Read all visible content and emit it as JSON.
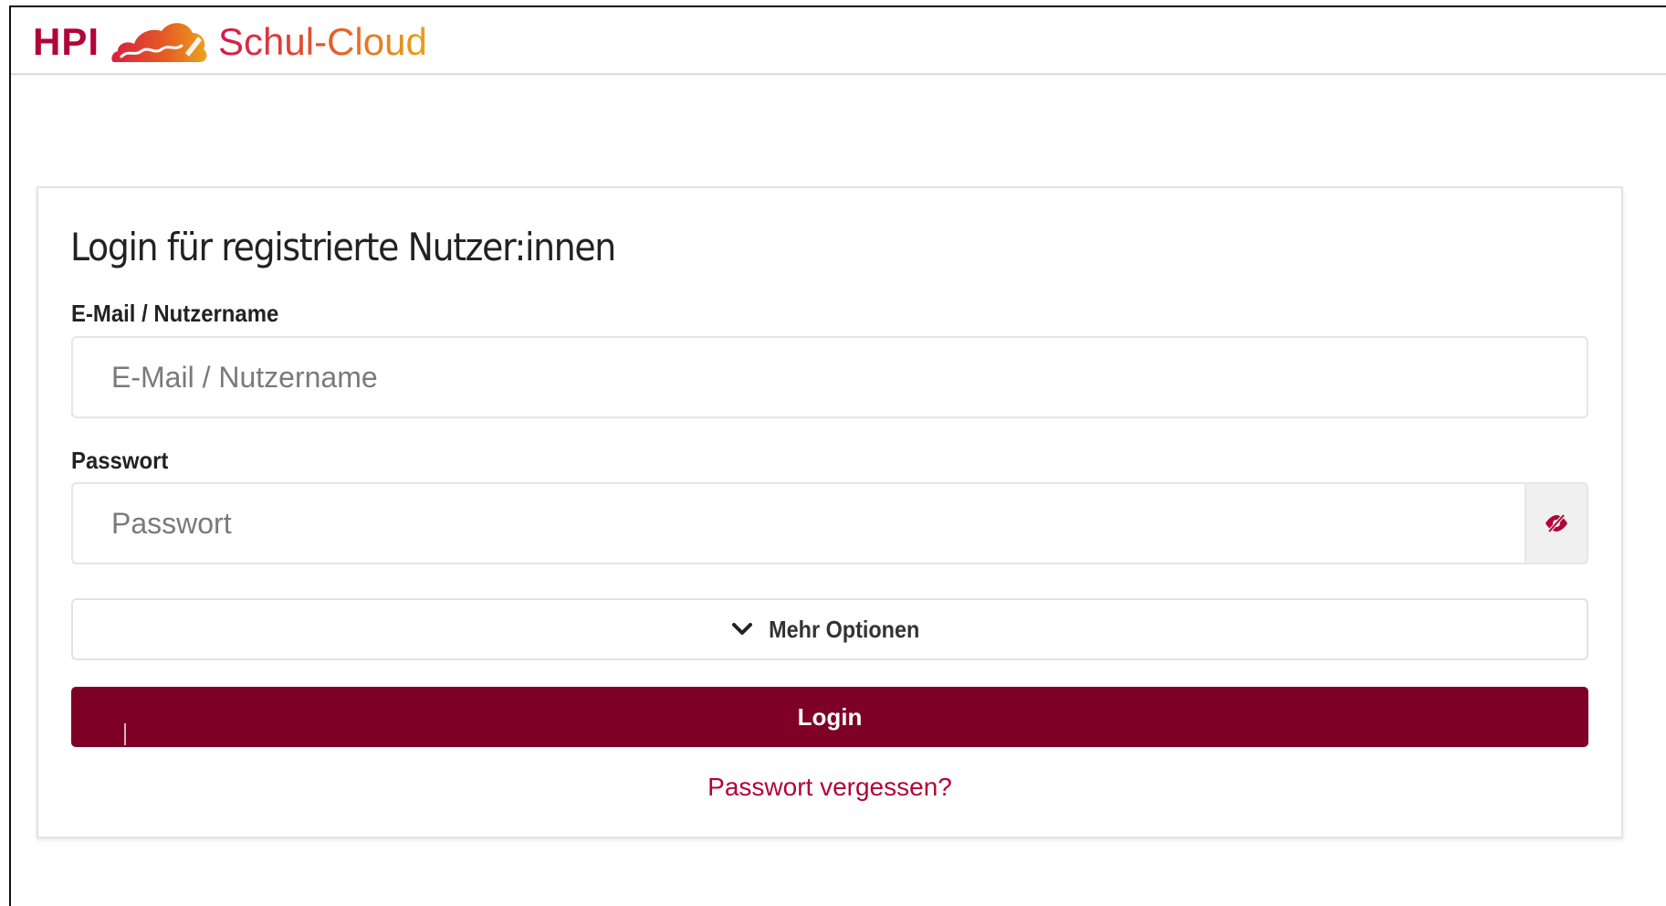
{
  "header": {
    "logo_hpi": "HPI",
    "logo_name": "Schul-Cloud",
    "logo_icon": "cloud-logo-icon"
  },
  "login": {
    "title": "Login für registrierte Nutzer:innen",
    "email_label": "E-Mail / Nutzername",
    "email_placeholder": "E-Mail / Nutzername",
    "email_value": "",
    "password_label": "Passwort",
    "password_placeholder": "Passwort",
    "password_value": "",
    "toggle_visibility_icon": "eye-slash-icon",
    "more_options_icon": "chevron-down-icon",
    "more_options_label": "Mehr Optionen",
    "login_button_label": "Login",
    "forgot_password_label": "Passwort vergessen?"
  },
  "colors": {
    "brand_primary": "#7e0027",
    "brand_accent": "#b10438",
    "logo_gradient_start": "#d21b4d",
    "logo_gradient_end": "#e8a21a",
    "input_border": "#e6e6e6",
    "eye_button_bg": "#f0f0f0"
  }
}
